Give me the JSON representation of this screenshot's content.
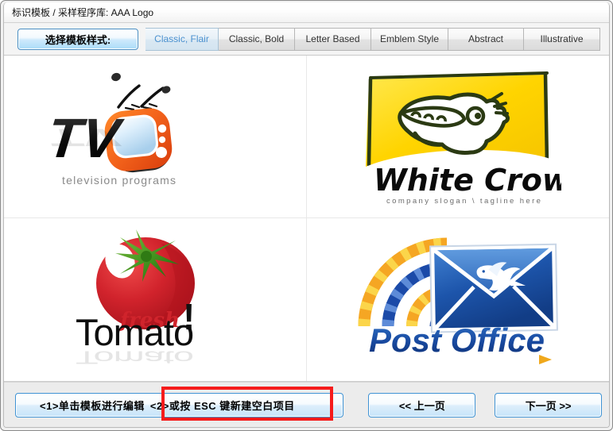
{
  "window": {
    "title": "标识模板 / 采样程序库: AAA Logo"
  },
  "toolbar": {
    "style_button_label": "选择模板样式:",
    "tabs": [
      {
        "label": "Classic, Flair",
        "selected": true
      },
      {
        "label": "Classic, Bold",
        "selected": false
      },
      {
        "label": "Letter Based",
        "selected": false
      },
      {
        "label": "Emblem Style",
        "selected": false
      },
      {
        "label": "Abstract",
        "selected": false
      },
      {
        "label": "Illustrative",
        "selected": false
      }
    ]
  },
  "grid": {
    "templates": [
      {
        "name": "TV",
        "title_text": "TV",
        "tagline": "television programs",
        "colors": {
          "primary": "#f0621e",
          "accent": "#cfe8fb",
          "text": "#1a1a1a"
        }
      },
      {
        "name": "White Crow",
        "title_text": "White Crow",
        "tagline": "company slogan \\ tagline here",
        "colors": {
          "primary": "#ffd915",
          "accent": "#1e3312",
          "text": "#111111"
        }
      },
      {
        "name": "Tomato",
        "title_text": "Tomato",
        "sub_text": "fresh",
        "exclaim": "!",
        "tagline": "",
        "colors": {
          "primary": "#cf1f26",
          "accent": "#3f8f1d",
          "text": "#111111"
        }
      },
      {
        "name": "Post Office",
        "title_text": "Post Office",
        "tagline": "",
        "colors": {
          "primary": "#1b4aa8",
          "accent": "#f6b616",
          "text": "#1b4aa8"
        }
      }
    ]
  },
  "bottom": {
    "hint_part1": "<1>单击模板进行编辑",
    "hint_part2": "<2>或按 ESC 键新建空白项目",
    "prev_label": "<< 上一页",
    "next_label": "下一页 >>"
  },
  "annotation": {
    "highlight_color": "#f51c1c"
  }
}
